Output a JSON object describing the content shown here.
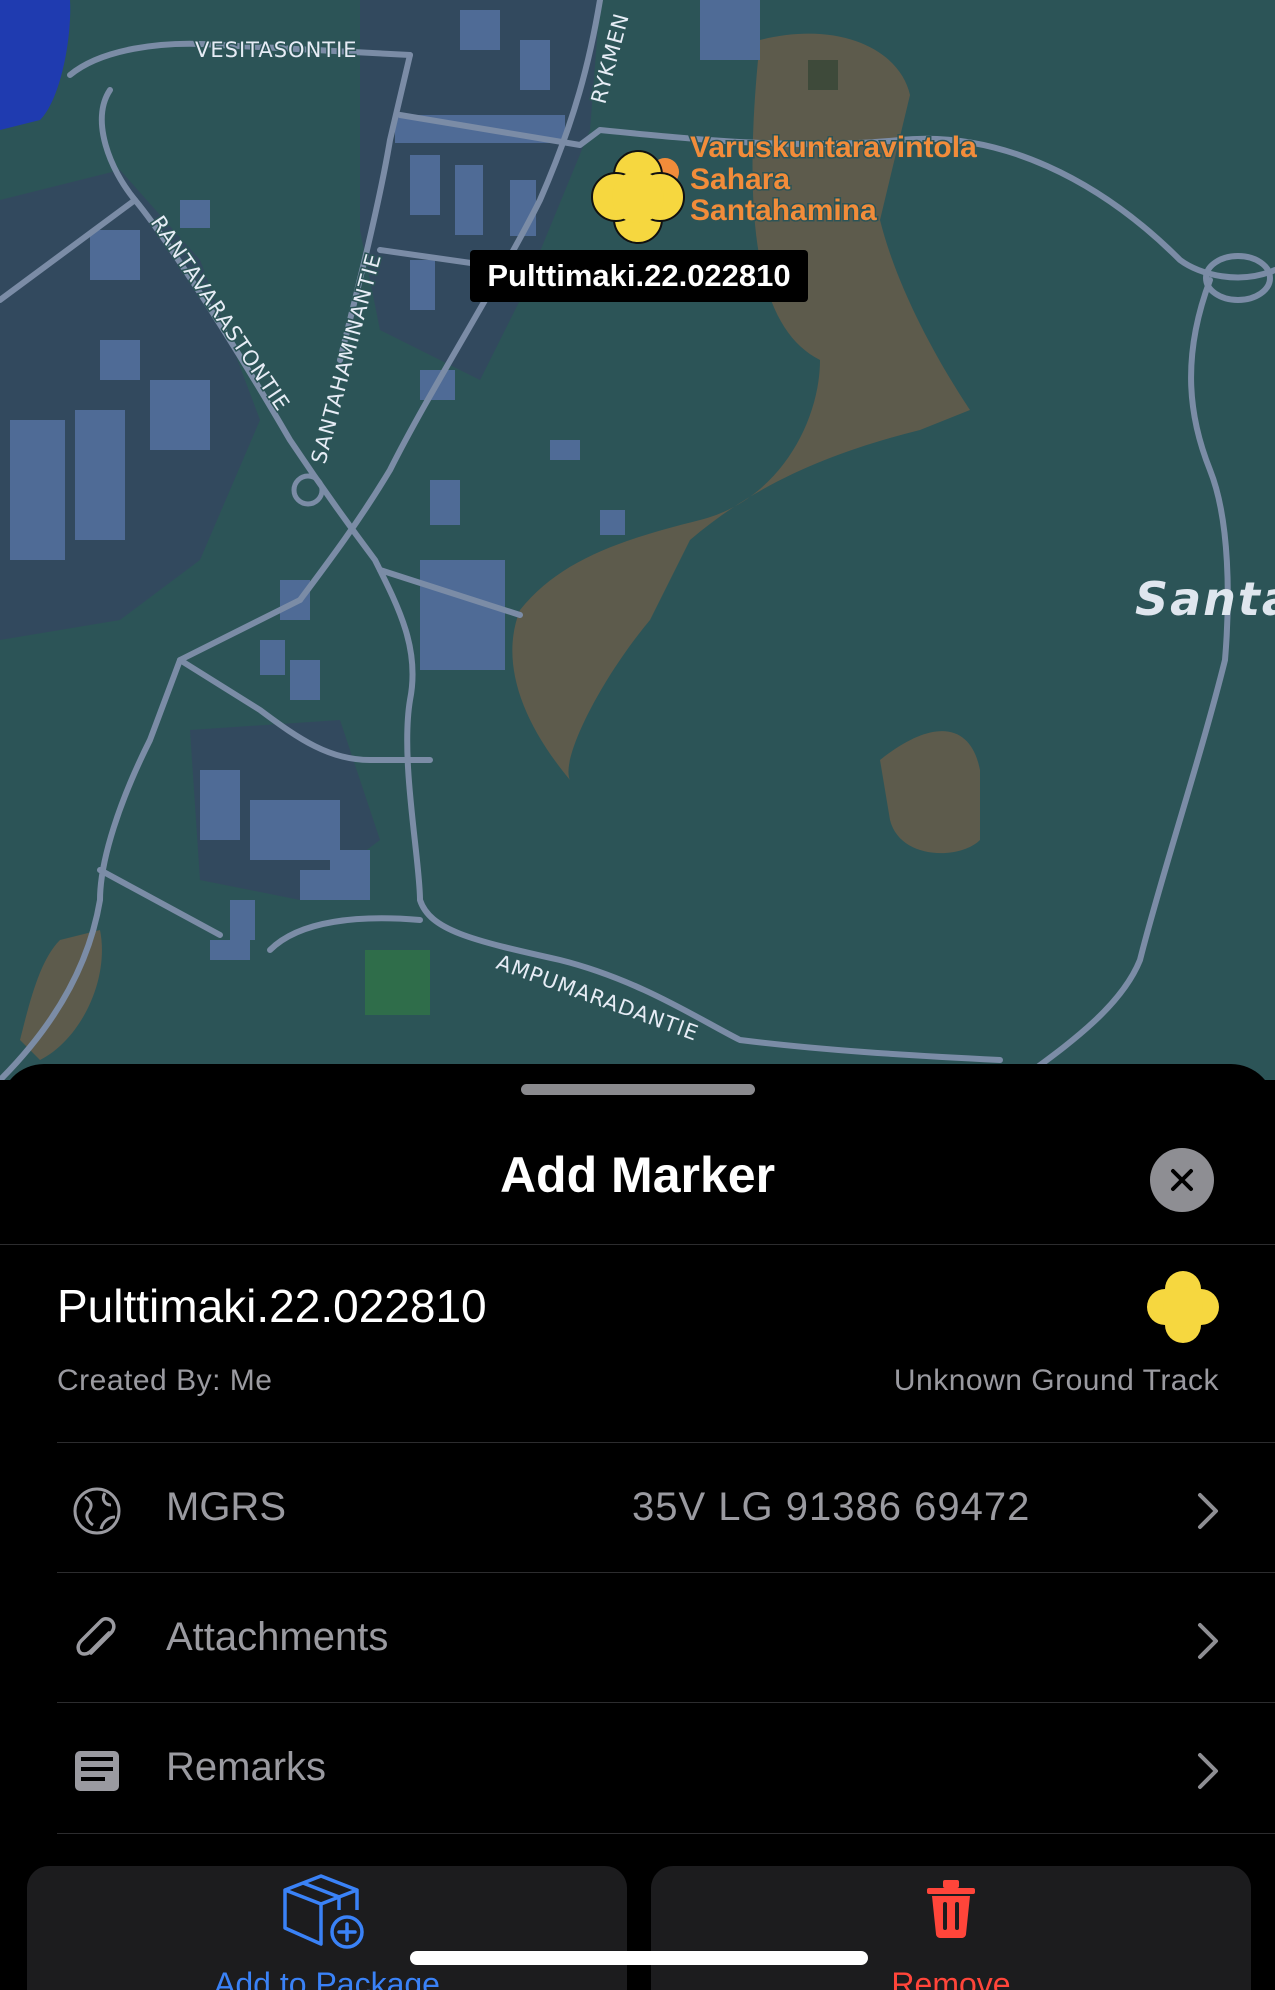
{
  "map": {
    "colors": {
      "land": "#2c5457",
      "area": "#3e4f6e",
      "building": "#4f6b96",
      "road": "#7b8ca6",
      "poi": "#f28c3a",
      "sand": "#6e5d48",
      "marker": "#f6d73f"
    },
    "street_labels": [
      "VESITASONTIE",
      "RANTAVARASTONTIE",
      "SANTAHAMINANTIE",
      "RYKMEN",
      "AMPUMARADANTIE"
    ],
    "poi_label_lines": [
      "Varuskuntaravintola",
      "Sahara",
      "Santahamina"
    ],
    "marker_callout": "Pulttimaki.22.022810",
    "region_label": "Santa"
  },
  "sheet": {
    "title": "Add Marker",
    "close_icon": "xmark-icon",
    "marker_name": "Pulttimaki.22.022810",
    "created_by": "Created By: Me",
    "track_type": "Unknown Ground Track",
    "rows": [
      {
        "icon": "globe-icon",
        "label": "MGRS",
        "value": "35V LG 91386 69472"
      },
      {
        "icon": "paperclip-icon",
        "label": "Attachments",
        "value": ""
      },
      {
        "icon": "remarks-icon",
        "label": "Remarks",
        "value": ""
      }
    ],
    "actions": {
      "add_to_package": {
        "label": "Add to Package",
        "icon": "package-plus-icon",
        "color": "#3a82f7"
      },
      "remove": {
        "label": "Remove",
        "icon": "trash-icon",
        "color": "#ff453a"
      }
    }
  }
}
